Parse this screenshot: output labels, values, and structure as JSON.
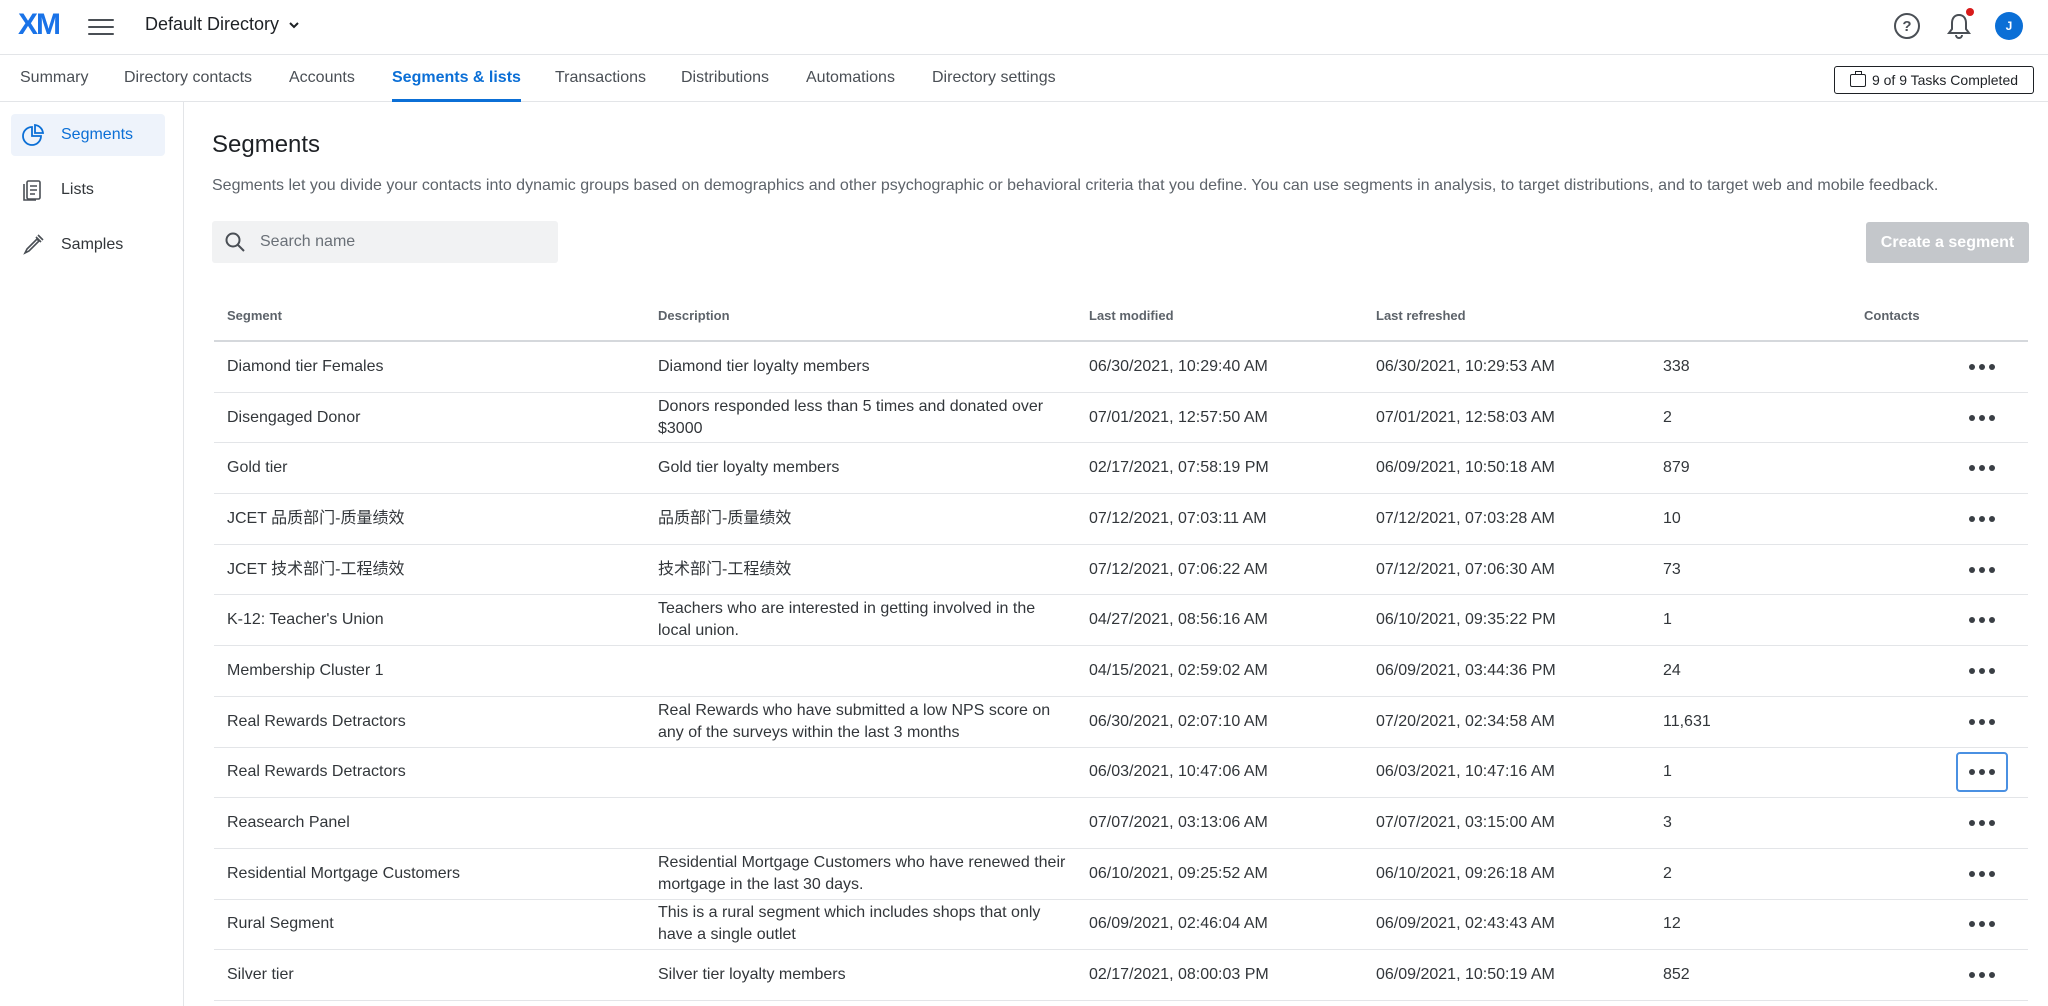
{
  "header": {
    "logo": "XM",
    "directory_title": "Default Directory",
    "help_symbol": "?",
    "avatar_initial": "J"
  },
  "tabs": [
    {
      "label": "Summary"
    },
    {
      "label": "Directory contacts"
    },
    {
      "label": "Accounts"
    },
    {
      "label": "Segments & lists",
      "active": true
    },
    {
      "label": "Transactions"
    },
    {
      "label": "Distributions"
    },
    {
      "label": "Automations"
    },
    {
      "label": "Directory settings"
    }
  ],
  "tasks_button": "9 of 9 Tasks Completed",
  "sidebar": {
    "items": [
      {
        "label": "Segments",
        "icon": "pie-chart-icon",
        "active": true
      },
      {
        "label": "Lists",
        "icon": "list-icon"
      },
      {
        "label": "Samples",
        "icon": "pipette-icon"
      }
    ]
  },
  "main": {
    "title": "Segments",
    "description": "Segments let you divide your contacts into dynamic groups based on demographics and other psychographic or behavioral criteria that you define. You can use segments in analysis, to target distributions, and to target web and mobile feedback.",
    "search_placeholder": "Search name",
    "create_button": "Create a segment"
  },
  "table": {
    "columns": [
      "Segment",
      "Description",
      "Last modified",
      "Last refreshed",
      "Contacts"
    ],
    "rows": [
      {
        "segment": "Diamond tier Females",
        "description": "Diamond tier loyalty members",
        "modified": "06/30/2021, 10:29:40 AM",
        "refreshed": "06/30/2021, 10:29:53 AM",
        "contacts": "338"
      },
      {
        "segment": "Disengaged Donor",
        "description": "Donors responded less than 5 times and donated over $3000",
        "modified": "07/01/2021, 12:57:50 AM",
        "refreshed": "07/01/2021, 12:58:03 AM",
        "contacts": "2"
      },
      {
        "segment": "Gold tier",
        "description": "Gold tier loyalty members",
        "modified": "02/17/2021, 07:58:19 PM",
        "refreshed": "06/09/2021, 10:50:18 AM",
        "contacts": "879"
      },
      {
        "segment": "JCET 品质部门-质量绩效",
        "description": "品质部门-质量绩效",
        "modified": "07/12/2021, 07:03:11 AM",
        "refreshed": "07/12/2021, 07:03:28 AM",
        "contacts": "10"
      },
      {
        "segment": "JCET 技术部门-工程绩效",
        "description": "技术部门-工程绩效",
        "modified": "07/12/2021, 07:06:22 AM",
        "refreshed": "07/12/2021, 07:06:30 AM",
        "contacts": "73"
      },
      {
        "segment": "K-12: Teacher's Union",
        "description": "Teachers who are interested in getting involved in the local union.",
        "modified": "04/27/2021, 08:56:16 AM",
        "refreshed": "06/10/2021, 09:35:22 PM",
        "contacts": "1"
      },
      {
        "segment": "Membership Cluster 1",
        "description": "",
        "modified": "04/15/2021, 02:59:02 AM",
        "refreshed": "06/09/2021, 03:44:36 PM",
        "contacts": "24"
      },
      {
        "segment": "Real Rewards Detractors",
        "description": "Real Rewards who have submitted a low NPS score on any of the surveys within the last 3 months",
        "modified": "06/30/2021, 02:07:10 AM",
        "refreshed": "07/20/2021, 02:34:58 AM",
        "contacts": "11,631"
      },
      {
        "segment": "Real Rewards Detractors",
        "description": "",
        "modified": "06/03/2021, 10:47:06 AM",
        "refreshed": "06/03/2021, 10:47:16 AM",
        "contacts": "1",
        "focused": true
      },
      {
        "segment": "Reasearch Panel",
        "description": "",
        "modified": "07/07/2021, 03:13:06 AM",
        "refreshed": "07/07/2021, 03:15:00 AM",
        "contacts": "3"
      },
      {
        "segment": "Residential Mortgage Customers",
        "description": "Residential Mortgage Customers who have renewed their mortgage in the last 30 days.",
        "modified": "06/10/2021, 09:25:52 AM",
        "refreshed": "06/10/2021, 09:26:18 AM",
        "contacts": "2"
      },
      {
        "segment": "Rural Segment",
        "description": "This is a rural segment which includes shops that only have a single outlet",
        "modified": "06/09/2021, 02:46:04 AM",
        "refreshed": "06/09/2021, 02:43:43 AM",
        "contacts": "12"
      },
      {
        "segment": "Silver tier",
        "description": "Silver tier loyalty members",
        "modified": "02/17/2021, 08:00:03 PM",
        "refreshed": "06/09/2021, 10:50:19 AM",
        "contacts": "852"
      }
    ]
  },
  "colors": {
    "accent": "#0b6fd6",
    "notification_dot": "#d81b1b",
    "disabled_button": "#c4c7cb"
  }
}
